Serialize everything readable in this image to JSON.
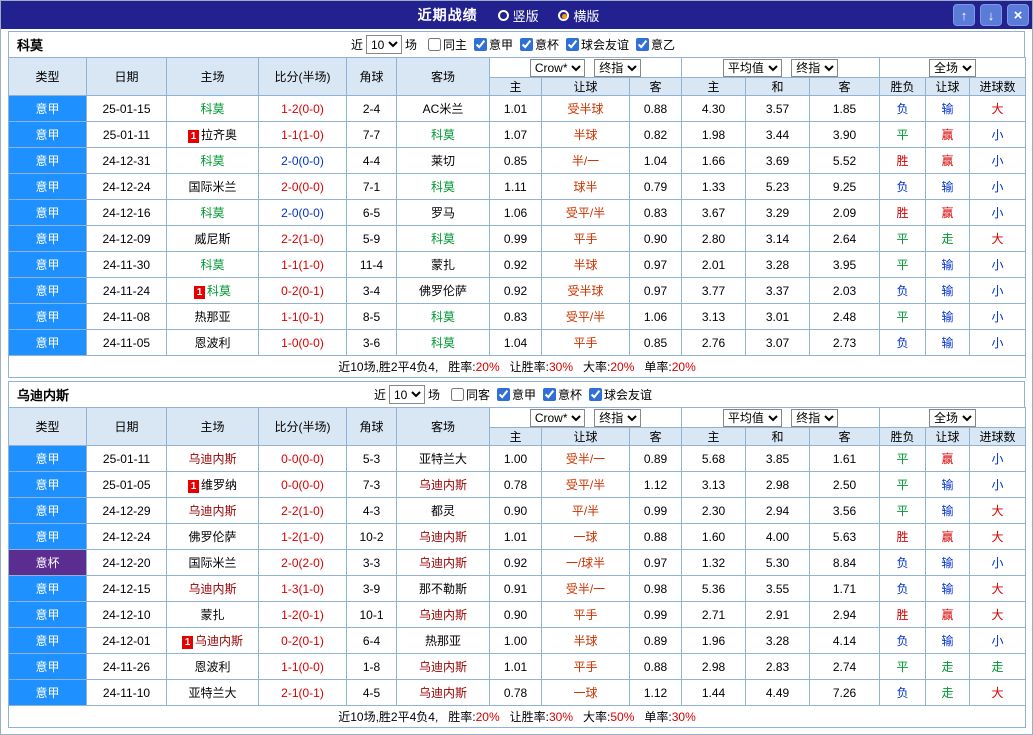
{
  "titlebar": {
    "title": "近期战绩",
    "radio_vertical": "竖版",
    "radio_horizontal": "横版",
    "up_arrow": "↑",
    "down_arrow": "↓",
    "close": "×"
  },
  "filter": {
    "near_label": "近",
    "count": "10",
    "games_label": "场"
  },
  "badge_label": "1",
  "table_header": {
    "col_type": "类型",
    "col_date": "日期",
    "col_home": "主场",
    "col_score": "比分(半场)",
    "col_corner": "角球",
    "col_away": "客场",
    "odds_select_1": "Crow*",
    "odds_select_2": "终指",
    "avg_select_1": "平均值",
    "avg_select_2": "终指",
    "full_select": "全场",
    "sub_home": "主",
    "sub_handicap": "让球",
    "sub_away": "客",
    "sub_avg_home": "主",
    "sub_avg_draw": "和",
    "sub_avg_away": "客",
    "sub_result": "胜负",
    "sub_handicap_result": "让球",
    "sub_goals": "进球数"
  },
  "league_colors": {
    "意甲": "#1e90ff",
    "意杯": "#5c2d91"
  },
  "result_colors": {
    "胜": "red",
    "赢": "red",
    "大": "red",
    "负": "blue",
    "输": "blue",
    "小": "blue",
    "平": "green",
    "走": "green"
  },
  "colors": {
    "titlebar_bg": "#22218f",
    "titlebar_button_bg": "#5a7bd8",
    "radio_selected_dot": "#ff9900",
    "header_bg": "#d9e6f3",
    "grid_border": "#8fb2d5",
    "serie_a_bg": "#1e90ff",
    "coppa_italia_bg": "#5c2d91",
    "positive_red": "#d80000",
    "negative_blue": "#0033cc",
    "push_green": "#009933",
    "handicap_text": "#cc3300",
    "badge_bg": "#e60000",
    "como_team_color": "#009933",
    "udinese_team_color": "#990000"
  },
  "sections": [
    {
      "team": "科莫",
      "team_color": "#009933",
      "filters": [
        {
          "label": "同主",
          "checked": false
        },
        {
          "label": "意甲",
          "checked": true
        },
        {
          "label": "意杯",
          "checked": true
        },
        {
          "label": "球会友谊",
          "checked": true
        },
        {
          "label": "意乙",
          "checked": true
        }
      ],
      "rows": [
        {
          "league": "意甲",
          "date": "25-01-15",
          "home": "科莫",
          "home_focal": true,
          "home_badge": false,
          "score": "1-2(0-0)",
          "score_color": "red",
          "corners": "2-4",
          "away": "AC米兰",
          "away_focal": false,
          "away_badge": false,
          "odds": [
            "1.01",
            "受半球",
            "0.88"
          ],
          "avg": [
            "4.30",
            "3.57",
            "1.85"
          ],
          "results": [
            "负",
            "输",
            "大"
          ]
        },
        {
          "league": "意甲",
          "date": "25-01-11",
          "home": "拉齐奥",
          "home_focal": false,
          "home_badge": true,
          "score": "1-1(1-0)",
          "score_color": "red",
          "corners": "7-7",
          "away": "科莫",
          "away_focal": true,
          "away_badge": false,
          "odds": [
            "1.07",
            "半球",
            "0.82"
          ],
          "avg": [
            "1.98",
            "3.44",
            "3.90"
          ],
          "results": [
            "平",
            "赢",
            "小"
          ]
        },
        {
          "league": "意甲",
          "date": "24-12-31",
          "home": "科莫",
          "home_focal": true,
          "home_badge": false,
          "score": "2-0(0-0)",
          "score_color": "blue",
          "corners": "4-4",
          "away": "莱切",
          "away_focal": false,
          "away_badge": false,
          "odds": [
            "0.85",
            "半/一",
            "1.04"
          ],
          "avg": [
            "1.66",
            "3.69",
            "5.52"
          ],
          "results": [
            "胜",
            "赢",
            "小"
          ]
        },
        {
          "league": "意甲",
          "date": "24-12-24",
          "home": "国际米兰",
          "home_focal": false,
          "home_badge": false,
          "score": "2-0(0-0)",
          "score_color": "red",
          "corners": "7-1",
          "away": "科莫",
          "away_focal": true,
          "away_badge": false,
          "odds": [
            "1.11",
            "球半",
            "0.79"
          ],
          "avg": [
            "1.33",
            "5.23",
            "9.25"
          ],
          "results": [
            "负",
            "输",
            "小"
          ]
        },
        {
          "league": "意甲",
          "date": "24-12-16",
          "home": "科莫",
          "home_focal": true,
          "home_badge": false,
          "score": "2-0(0-0)",
          "score_color": "blue",
          "corners": "6-5",
          "away": "罗马",
          "away_focal": false,
          "away_badge": false,
          "odds": [
            "1.06",
            "受平/半",
            "0.83"
          ],
          "avg": [
            "3.67",
            "3.29",
            "2.09"
          ],
          "results": [
            "胜",
            "赢",
            "小"
          ]
        },
        {
          "league": "意甲",
          "date": "24-12-09",
          "home": "威尼斯",
          "home_focal": false,
          "home_badge": false,
          "score": "2-2(1-0)",
          "score_color": "red",
          "corners": "5-9",
          "away": "科莫",
          "away_focal": true,
          "away_badge": false,
          "odds": [
            "0.99",
            "平手",
            "0.90"
          ],
          "avg": [
            "2.80",
            "3.14",
            "2.64"
          ],
          "results": [
            "平",
            "走",
            "大"
          ]
        },
        {
          "league": "意甲",
          "date": "24-11-30",
          "home": "科莫",
          "home_focal": true,
          "home_badge": false,
          "score": "1-1(1-0)",
          "score_color": "red",
          "corners": "11-4",
          "away": "蒙扎",
          "away_focal": false,
          "away_badge": false,
          "odds": [
            "0.92",
            "半球",
            "0.97"
          ],
          "avg": [
            "2.01",
            "3.28",
            "3.95"
          ],
          "results": [
            "平",
            "输",
            "小"
          ]
        },
        {
          "league": "意甲",
          "date": "24-11-24",
          "home": "科莫",
          "home_focal": true,
          "home_badge": true,
          "score": "0-2(0-1)",
          "score_color": "red",
          "corners": "3-4",
          "away": "佛罗伦萨",
          "away_focal": false,
          "away_badge": false,
          "odds": [
            "0.92",
            "受半球",
            "0.97"
          ],
          "avg": [
            "3.77",
            "3.37",
            "2.03"
          ],
          "results": [
            "负",
            "输",
            "小"
          ]
        },
        {
          "league": "意甲",
          "date": "24-11-08",
          "home": "热那亚",
          "home_focal": false,
          "home_badge": false,
          "score": "1-1(0-1)",
          "score_color": "red",
          "corners": "8-5",
          "away": "科莫",
          "away_focal": true,
          "away_badge": false,
          "odds": [
            "0.83",
            "受平/半",
            "1.06"
          ],
          "avg": [
            "3.13",
            "3.01",
            "2.48"
          ],
          "results": [
            "平",
            "输",
            "小"
          ]
        },
        {
          "league": "意甲",
          "date": "24-11-05",
          "home": "恩波利",
          "home_focal": false,
          "home_badge": false,
          "score": "1-0(0-0)",
          "score_color": "red",
          "corners": "3-6",
          "away": "科莫",
          "away_focal": true,
          "away_badge": false,
          "odds": [
            "1.04",
            "平手",
            "0.85"
          ],
          "avg": [
            "2.76",
            "3.07",
            "2.73"
          ],
          "results": [
            "负",
            "输",
            "小"
          ]
        }
      ],
      "summary": {
        "prefix": "近10场,胜2平4负4,",
        "stats": [
          {
            "label": "胜率:",
            "value": "20%"
          },
          {
            "label": "让胜率:",
            "value": "30%"
          },
          {
            "label": "大率:",
            "value": "20%"
          },
          {
            "label": "单率:",
            "value": "20%"
          }
        ]
      }
    },
    {
      "team": "乌迪内斯",
      "team_color": "#990000",
      "filters": [
        {
          "label": "同客",
          "checked": false
        },
        {
          "label": "意甲",
          "checked": true
        },
        {
          "label": "意杯",
          "checked": true
        },
        {
          "label": "球会友谊",
          "checked": true
        }
      ],
      "rows": [
        {
          "league": "意甲",
          "date": "25-01-11",
          "home": "乌迪内斯",
          "home_focal": true,
          "home_badge": false,
          "score": "0-0(0-0)",
          "score_color": "red",
          "corners": "5-3",
          "away": "亚特兰大",
          "away_focal": false,
          "away_badge": false,
          "odds": [
            "1.00",
            "受半/一",
            "0.89"
          ],
          "avg": [
            "5.68",
            "3.85",
            "1.61"
          ],
          "results": [
            "平",
            "赢",
            "小"
          ]
        },
        {
          "league": "意甲",
          "date": "25-01-05",
          "home": "维罗纳",
          "home_focal": false,
          "home_badge": true,
          "score": "0-0(0-0)",
          "score_color": "red",
          "corners": "7-3",
          "away": "乌迪内斯",
          "away_focal": true,
          "away_badge": false,
          "odds": [
            "0.78",
            "受平/半",
            "1.12"
          ],
          "avg": [
            "3.13",
            "2.98",
            "2.50"
          ],
          "results": [
            "平",
            "输",
            "小"
          ]
        },
        {
          "league": "意甲",
          "date": "24-12-29",
          "home": "乌迪内斯",
          "home_focal": true,
          "home_badge": false,
          "score": "2-2(1-0)",
          "score_color": "red",
          "corners": "4-3",
          "away": "都灵",
          "away_focal": false,
          "away_badge": false,
          "odds": [
            "0.90",
            "平/半",
            "0.99"
          ],
          "avg": [
            "2.30",
            "2.94",
            "3.56"
          ],
          "results": [
            "平",
            "输",
            "大"
          ]
        },
        {
          "league": "意甲",
          "date": "24-12-24",
          "home": "佛罗伦萨",
          "home_focal": false,
          "home_badge": false,
          "score": "1-2(1-0)",
          "score_color": "red",
          "corners": "10-2",
          "away": "乌迪内斯",
          "away_focal": true,
          "away_badge": false,
          "odds": [
            "1.01",
            "一球",
            "0.88"
          ],
          "avg": [
            "1.60",
            "4.00",
            "5.63"
          ],
          "results": [
            "胜",
            "赢",
            "大"
          ]
        },
        {
          "league": "意杯",
          "date": "24-12-20",
          "home": "国际米兰",
          "home_focal": false,
          "home_badge": false,
          "score": "2-0(2-0)",
          "score_color": "red",
          "corners": "3-3",
          "away": "乌迪内斯",
          "away_focal": true,
          "away_badge": false,
          "odds": [
            "0.92",
            "一/球半",
            "0.97"
          ],
          "avg": [
            "1.32",
            "5.30",
            "8.84"
          ],
          "results": [
            "负",
            "输",
            "小"
          ]
        },
        {
          "league": "意甲",
          "date": "24-12-15",
          "home": "乌迪内斯",
          "home_focal": true,
          "home_badge": false,
          "score": "1-3(1-0)",
          "score_color": "red",
          "corners": "3-9",
          "away": "那不勒斯",
          "away_focal": false,
          "away_badge": false,
          "odds": [
            "0.91",
            "受半/一",
            "0.98"
          ],
          "avg": [
            "5.36",
            "3.55",
            "1.71"
          ],
          "results": [
            "负",
            "输",
            "大"
          ]
        },
        {
          "league": "意甲",
          "date": "24-12-10",
          "home": "蒙扎",
          "home_focal": false,
          "home_badge": false,
          "score": "1-2(0-1)",
          "score_color": "red",
          "corners": "10-1",
          "away": "乌迪内斯",
          "away_focal": true,
          "away_badge": false,
          "odds": [
            "0.90",
            "平手",
            "0.99"
          ],
          "avg": [
            "2.71",
            "2.91",
            "2.94"
          ],
          "results": [
            "胜",
            "赢",
            "大"
          ]
        },
        {
          "league": "意甲",
          "date": "24-12-01",
          "home": "乌迪内斯",
          "home_focal": true,
          "home_badge": true,
          "score": "0-2(0-1)",
          "score_color": "red",
          "corners": "6-4",
          "away": "热那亚",
          "away_focal": false,
          "away_badge": false,
          "odds": [
            "1.00",
            "半球",
            "0.89"
          ],
          "avg": [
            "1.96",
            "3.28",
            "4.14"
          ],
          "results": [
            "负",
            "输",
            "小"
          ]
        },
        {
          "league": "意甲",
          "date": "24-11-26",
          "home": "恩波利",
          "home_focal": false,
          "home_badge": false,
          "score": "1-1(0-0)",
          "score_color": "red",
          "corners": "1-8",
          "away": "乌迪内斯",
          "away_focal": true,
          "away_badge": false,
          "odds": [
            "1.01",
            "平手",
            "0.88"
          ],
          "avg": [
            "2.98",
            "2.83",
            "2.74"
          ],
          "results": [
            "平",
            "走",
            "走"
          ]
        },
        {
          "league": "意甲",
          "date": "24-11-10",
          "home": "亚特兰大",
          "home_focal": false,
          "home_badge": false,
          "score": "2-1(0-1)",
          "score_color": "red",
          "corners": "4-5",
          "away": "乌迪内斯",
          "away_focal": true,
          "away_badge": false,
          "odds": [
            "0.78",
            "一球",
            "1.12"
          ],
          "avg": [
            "1.44",
            "4.49",
            "7.26"
          ],
          "results": [
            "负",
            "走",
            "大"
          ]
        }
      ],
      "summary": {
        "prefix": "近10场,胜2平4负4,",
        "stats": [
          {
            "label": "胜率:",
            "value": "20%"
          },
          {
            "label": "让胜率:",
            "value": "30%"
          },
          {
            "label": "大率:",
            "value": "50%"
          },
          {
            "label": "单率:",
            "value": "30%"
          }
        ]
      }
    }
  ]
}
